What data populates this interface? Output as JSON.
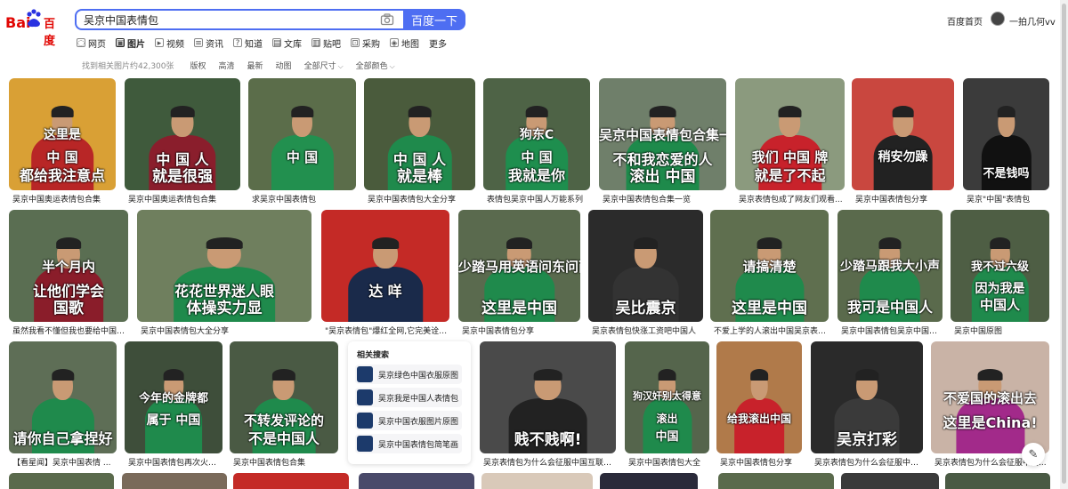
{
  "header": {
    "logo_left": "Bai",
    "logo_right": "百度",
    "search_value": "吴京中国表情包",
    "search_button": "百度一下",
    "home_link": "百度首页",
    "user_name": "一拍几何vv"
  },
  "tabs": [
    {
      "label": "网页",
      "icon": "globe-icon"
    },
    {
      "label": "图片",
      "icon": "image-icon",
      "active": true
    },
    {
      "label": "视频",
      "icon": "video-icon"
    },
    {
      "label": "资讯",
      "icon": "news-icon"
    },
    {
      "label": "知道",
      "icon": "question-icon"
    },
    {
      "label": "文库",
      "icon": "doc-icon"
    },
    {
      "label": "贴吧",
      "icon": "forum-icon"
    },
    {
      "label": "采购",
      "icon": "cart-icon"
    },
    {
      "label": "地图",
      "icon": "map-icon"
    },
    {
      "label": "更多",
      "icon": ""
    }
  ],
  "filters": {
    "result_count": "找到相关图片约42,300张",
    "items": [
      "版权",
      "高清",
      "最新",
      "动图",
      "全部尺寸",
      "全部颜色"
    ]
  },
  "images": [
    {
      "caption": "吴京中国奥运表情包合集",
      "bg": "#d9a035",
      "body": "#b82626",
      "top_text": "这里是",
      "mid_text": "中 国",
      "bottom_text": "都给我注意点"
    },
    {
      "caption": "吴京中国奥运表情包合集",
      "bg": "#3f5a3c",
      "body": "#8a1e2c",
      "top_text": "",
      "mid_text": "中 国 人",
      "bottom_text": "就是很强"
    },
    {
      "caption": "求吴京中国表情包",
      "bg": "#5b6d4a",
      "body": "#22904f",
      "top_text": "",
      "mid_text": "中 国",
      "bottom_text": ""
    },
    {
      "caption": "吴京中国表情包大全分享",
      "bg": "#4a5b3c",
      "body": "#1f8a4c",
      "top_text": "",
      "mid_text": "中 国 人",
      "bottom_text": "就是棒"
    },
    {
      "caption": "表情包吴京中国人万能系列",
      "bg": "#4e6346",
      "body": "#1e8e4e",
      "top_text": "狗东C",
      "mid_text": "中 国",
      "bottom_text": "我就是你"
    },
    {
      "caption": "吴京中国表情包合集一览",
      "bg": "#6f7f6a",
      "body": "#1e8a4b",
      "top_text": "吴京中国表情包合集一览",
      "mid_text": "不和我恋爱的人",
      "bottom_text": "滚出 中国"
    },
    {
      "caption": "吴京表情包成了网友们观看...",
      "bg": "#8b9a7e",
      "body": "#c8222b",
      "top_text": "",
      "mid_text": "我们 中国 牌",
      "bottom_text": "就是了不起"
    },
    {
      "caption": "吴京中国表情包分享",
      "bg": "#c9473f",
      "body": "#222222",
      "top_text": "",
      "mid_text": "稍安勿躁",
      "bottom_text": ""
    },
    {
      "caption": "吴京\"中国\"表情包",
      "bg": "#3b3b3b",
      "body": "#111111",
      "top_text": "",
      "mid_text": "",
      "bottom_text": "不是钱吗"
    },
    {
      "caption": "虽然我看不懂但我也要给中国队...",
      "bg": "#5a6e52",
      "body": "#8a1d2a",
      "top_text": "半个月内",
      "mid_text": "让他们学会",
      "bottom_text": "国歌"
    },
    {
      "caption": "吴京中国表情包大全分享",
      "bg": "#6f7f5e",
      "body": "#1f8a4c",
      "top_text": "",
      "mid_text": "花花世界迷人眼",
      "bottom_text": "体操实力显"
    },
    {
      "caption": "\"吴京表情包\"爆红全网,它完美诠释...",
      "bg": "#c42a26",
      "body": "#1a2a4a",
      "top_text": "",
      "mid_text": "达   咩",
      "bottom_text": ""
    },
    {
      "caption": "吴京中国表情包分享",
      "bg": "#5a6a4e",
      "body": "#1f8a4c",
      "top_text": "少踏马用英语问东问西",
      "mid_text": "",
      "bottom_text": "这里是中国"
    },
    {
      "caption": "吴京表情包快涨工资吧中国人",
      "bg": "#2b2b2b",
      "body": "#333333",
      "top_text": "",
      "mid_text": "",
      "bottom_text": "吴比震京"
    },
    {
      "caption": "不爱上学的人滚出中国吴京表情包",
      "bg": "#5f6f4f",
      "body": "#1f8a4c",
      "top_text": "请搞清楚",
      "mid_text": "",
      "bottom_text": "这里是中国"
    },
    {
      "caption": "吴京中国表情包吴京中国表...",
      "bg": "#5a6a4c",
      "body": "#1f8a4c",
      "top_text": "少踏马跟我大小声",
      "mid_text": "",
      "bottom_text": "我可是中国人"
    },
    {
      "caption": "吴京中国原图",
      "bg": "#4e5e44",
      "body": "#1f8a4c",
      "top_text": "我不过六级",
      "mid_text": "因为我是",
      "bottom_text": "中国人"
    },
    {
      "caption": "【看星闻】吴京中国表情 ...",
      "bg": "#5e6e56",
      "body": "#1f8a4c",
      "top_text": "",
      "mid_text": "",
      "bottom_text": "请你自己拿捏好"
    },
    {
      "caption": "吴京中国表情包再次火遍...",
      "bg": "#3e4e3a",
      "body": "#1f8a4c",
      "top_text": "今年的金牌都",
      "mid_text": "属于 中国",
      "bottom_text": ""
    },
    {
      "caption": "吴京中国表情包合集",
      "bg": "#4a5a44",
      "body": "#1f8a4c",
      "top_text": "",
      "mid_text": "不转发评论的",
      "bottom_text": "不是中国人"
    },
    {
      "caption": "吴京表情包为什么会征服中国互联网?...",
      "bg": "#4a4a4a",
      "body": "#222222",
      "top_text": "",
      "mid_text": "",
      "bottom_text": "贱不贱啊!"
    },
    {
      "caption": "吴京中国表情包大全",
      "bg": "#55654c",
      "body": "#1f8a4c",
      "top_text": "狗汉奸别太得意",
      "mid_text": "滚出",
      "bottom_text": "中国"
    },
    {
      "caption": "吴京中国表情包分享",
      "bg": "#b07a4a",
      "body": "#c8222b",
      "top_text": "",
      "mid_text": "给我滚出中国",
      "bottom_text": ""
    },
    {
      "caption": "吴京表情包为什么会征服中国...",
      "bg": "#2a2a2a",
      "body": "#3a3a3a",
      "top_text": "",
      "mid_text": "",
      "bottom_text": "吴京打彩"
    },
    {
      "caption": "吴京表情包为什么会征服中国...",
      "bg": "#c9b3a6",
      "body": "#a22a8a",
      "top_text": "不爱国的滚出去",
      "mid_text": "这里是China!",
      "bottom_text": ""
    }
  ],
  "related": {
    "title": "相关搜索",
    "items": [
      "吴京绿色中国衣服原图",
      "吴京我是中国人表情包",
      "吴京中国衣服图片原图",
      "吴京中国表情包简笔画"
    ]
  }
}
